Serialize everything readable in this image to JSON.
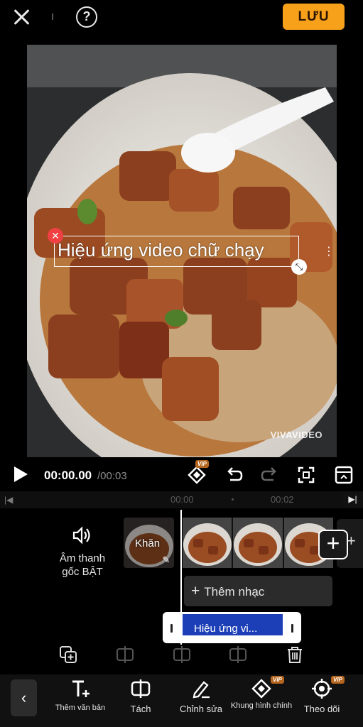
{
  "header": {
    "help_label": "?",
    "save_label": "LƯU"
  },
  "preview": {
    "overlay_text": "Hiệu ứng video chữ chạy",
    "watermark": "VIVAVIDEO"
  },
  "playback": {
    "current_time": "00:00.00",
    "total_time": "/00:03",
    "vip_label": "VIP"
  },
  "ruler": {
    "labels": [
      "00:00",
      "00:02"
    ]
  },
  "tracks": {
    "audio_label_line1": "Âm thanh",
    "audio_label_line2": "gốc BẬT",
    "clip1_label": "Khăn",
    "add_music_label": "Thêm nhạc",
    "text_clip_label": "Hiệu ứng vi..."
  },
  "toolbar": {
    "items": [
      {
        "label": "Thêm văn bản",
        "icon": "add-text-icon",
        "vip": false
      },
      {
        "label": "Tách",
        "icon": "split-icon",
        "vip": false
      },
      {
        "label": "Chỉnh sửa",
        "icon": "edit-pen-icon",
        "vip": false
      },
      {
        "label": "Khung hình chính",
        "icon": "keyframe-icon",
        "vip": true
      },
      {
        "label": "Theo dõi",
        "icon": "target-icon",
        "vip": true
      }
    ],
    "vip_label": "VIP"
  },
  "colors": {
    "accent": "#f7a01a",
    "text_clip": "#1c3fb8",
    "vip": "#b5651d",
    "delete": "#f04044"
  }
}
